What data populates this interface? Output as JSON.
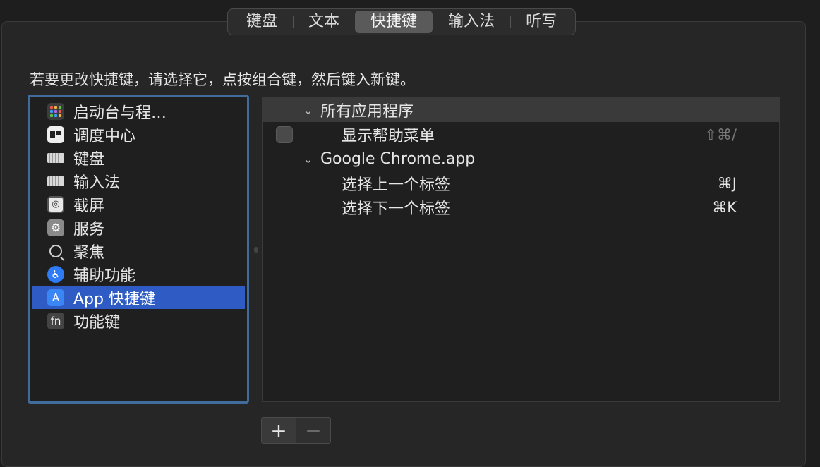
{
  "tabs": [
    {
      "label": "键盘",
      "active": false
    },
    {
      "label": "文本",
      "active": false
    },
    {
      "label": "快捷键",
      "active": true
    },
    {
      "label": "输入法",
      "active": false
    },
    {
      "label": "听写",
      "active": false
    }
  ],
  "instruction": "若要更改快捷键，请选择它，点按组合键，然后键入新键。",
  "sidebar": {
    "items": [
      {
        "label": "启动台与程…",
        "icon": "launchpad-icon"
      },
      {
        "label": "调度中心",
        "icon": "mission-control-icon"
      },
      {
        "label": "键盘",
        "icon": "keyboard-icon"
      },
      {
        "label": "输入法",
        "icon": "keyboard-icon"
      },
      {
        "label": "截屏",
        "icon": "screenshot-icon"
      },
      {
        "label": "服务",
        "icon": "gear-icon"
      },
      {
        "label": "聚焦",
        "icon": "magnifier-icon"
      },
      {
        "label": "辅助功能",
        "icon": "accessibility-icon"
      },
      {
        "label": "App 快捷键",
        "icon": "app-store-icon",
        "selected": true
      },
      {
        "label": "功能键",
        "icon": "fn-key-icon"
      }
    ]
  },
  "shortcuts": {
    "group_all": "所有应用程序",
    "show_help_menu": {
      "label": "显示帮助菜单",
      "shortcut": "⇧⌘/"
    },
    "group_chrome": "Google Chrome.app",
    "prev_tab": {
      "label": "选择上一个标签",
      "shortcut": "⌘J"
    },
    "next_tab": {
      "label": "选择下一个标签",
      "shortcut": "⌘K"
    }
  },
  "buttons": {
    "add": "+",
    "remove": "−"
  },
  "icons": {
    "shot_glyph": "◎",
    "service_glyph": "⚙",
    "access_glyph": "♿",
    "app_glyph": "A",
    "fn_glyph": "fn",
    "chevron": "⌄"
  },
  "colors": {
    "accent": "#2f5cc4",
    "focus_ring": "#3f6c9d",
    "background": "#1e1e1e"
  }
}
